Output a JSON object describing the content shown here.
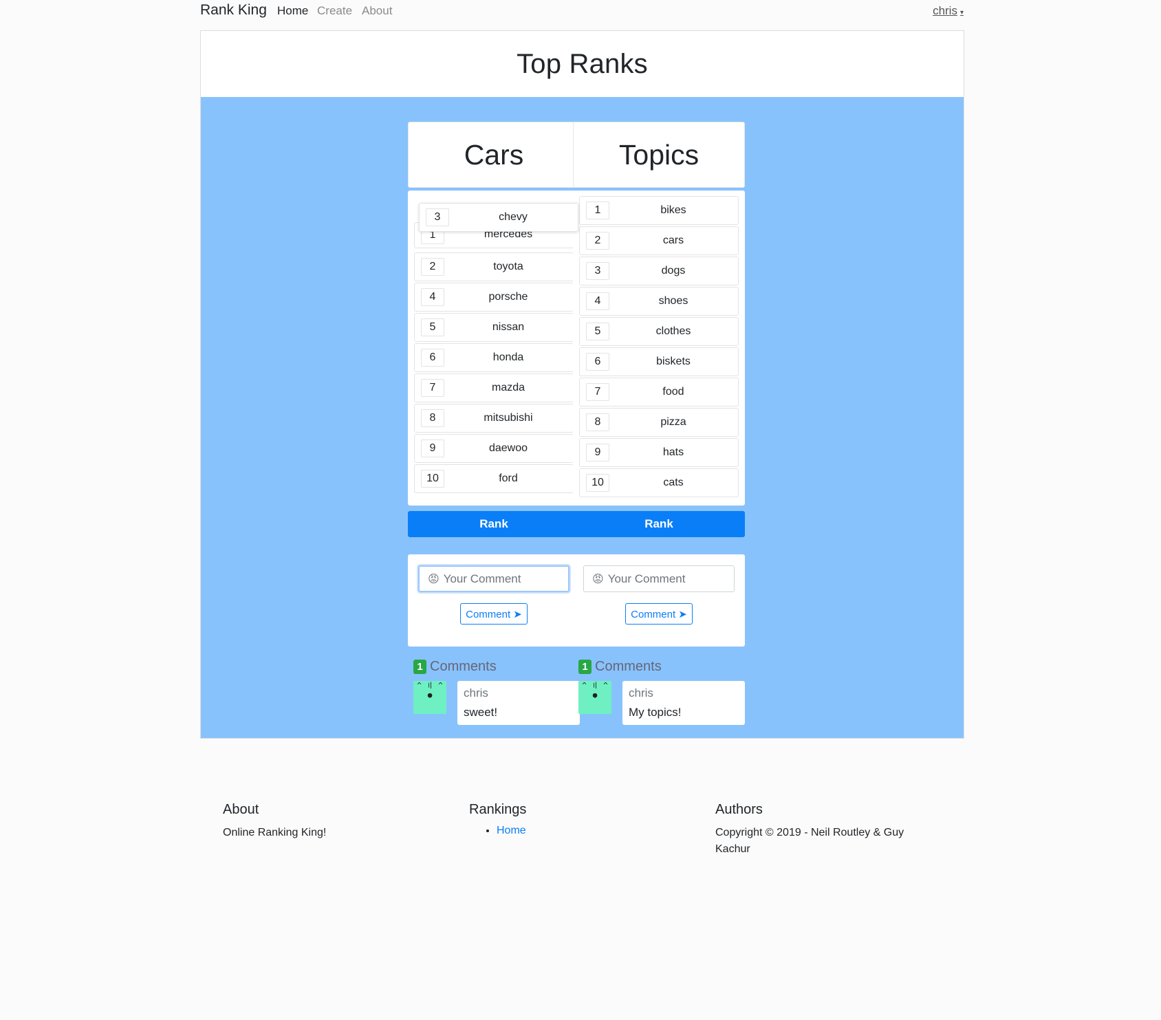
{
  "nav": {
    "brand": "Rank King",
    "links": [
      "Home",
      "Create",
      "About"
    ],
    "user": "chris"
  },
  "page_title": "Top Ranks",
  "columns": [
    {
      "title": "Cars",
      "dragging": {
        "num": "3",
        "name": "chevy"
      },
      "items": [
        {
          "num": "1",
          "name": "mercedes"
        },
        {
          "num": "2",
          "name": "toyota"
        },
        {
          "num": "4",
          "name": "porsche"
        },
        {
          "num": "5",
          "name": "nissan"
        },
        {
          "num": "6",
          "name": "honda"
        },
        {
          "num": "7",
          "name": "mazda"
        },
        {
          "num": "8",
          "name": "mitsubishi"
        },
        {
          "num": "9",
          "name": "daewoo"
        },
        {
          "num": "10",
          "name": "ford"
        }
      ],
      "rank_label": "Rank",
      "comment_placeholder": "Your Comment",
      "comment_button": "Comment ➤",
      "comment_count": "1",
      "comments_label": "Comments",
      "comments": [
        {
          "user": "chris",
          "text": "sweet!"
        }
      ]
    },
    {
      "title": "Topics",
      "items": [
        {
          "num": "1",
          "name": "bikes"
        },
        {
          "num": "2",
          "name": "cars"
        },
        {
          "num": "3",
          "name": "dogs"
        },
        {
          "num": "4",
          "name": "shoes"
        },
        {
          "num": "5",
          "name": "clothes"
        },
        {
          "num": "6",
          "name": "biskets"
        },
        {
          "num": "7",
          "name": "food"
        },
        {
          "num": "8",
          "name": "pizza"
        },
        {
          "num": "9",
          "name": "hats"
        },
        {
          "num": "10",
          "name": "cats"
        }
      ],
      "rank_label": "Rank",
      "comment_placeholder": "Your Comment",
      "comment_button": "Comment ➤",
      "comment_count": "1",
      "comments_label": "Comments",
      "comments": [
        {
          "user": "chris",
          "text": "My topics!"
        }
      ]
    }
  ],
  "footer": {
    "about_title": "About",
    "about_text": "Online Ranking King!",
    "rankings_title": "Rankings",
    "rankings_link": "Home",
    "authors_title": "Authors",
    "authors_line1": "Copyright © 2019 - Neil Routley & Guy",
    "authors_line2": "Kachur"
  },
  "colors": {
    "panel_bg": "#88c2fc",
    "primary": "#0a7ef7",
    "badge": "#28a745",
    "avatar": "#6ef0c2"
  }
}
